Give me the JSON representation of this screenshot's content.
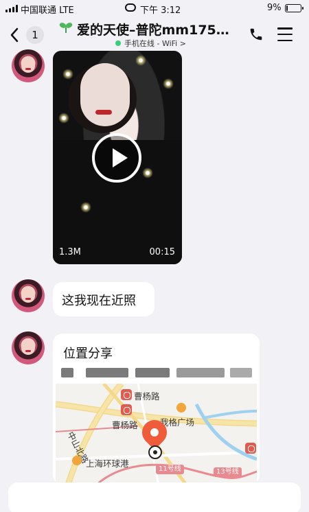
{
  "status_bar": {
    "carrier": "中国联通  LTE",
    "time": "下午 3:12",
    "battery_pct": "9%",
    "battery_level": 0.09
  },
  "header": {
    "unread_count": "1",
    "contact_name": "爱的天使–普陀mm175…",
    "online_status": "手机在线 - WiFi >",
    "icons": [
      "back-chevron-icon",
      "sprout-icon",
      "phone-icon",
      "menu-icon"
    ]
  },
  "messages": {
    "video": {
      "size": "1.3M",
      "duration": "00:15"
    },
    "text": "这我现在近照",
    "location": {
      "title": "位置分享",
      "map_labels": {
        "road_1": "曹杨路",
        "road_2": "曹杨路",
        "mall": "我格广场",
        "street": "中山北路",
        "port": "上海环球港",
        "line_11": "11号线",
        "line_13": "13号线"
      }
    }
  },
  "colors": {
    "background": "#f1f1f6",
    "bubble": "#ffffff",
    "online_dot": "#33d17a",
    "map_pin": "#f05b3a"
  }
}
